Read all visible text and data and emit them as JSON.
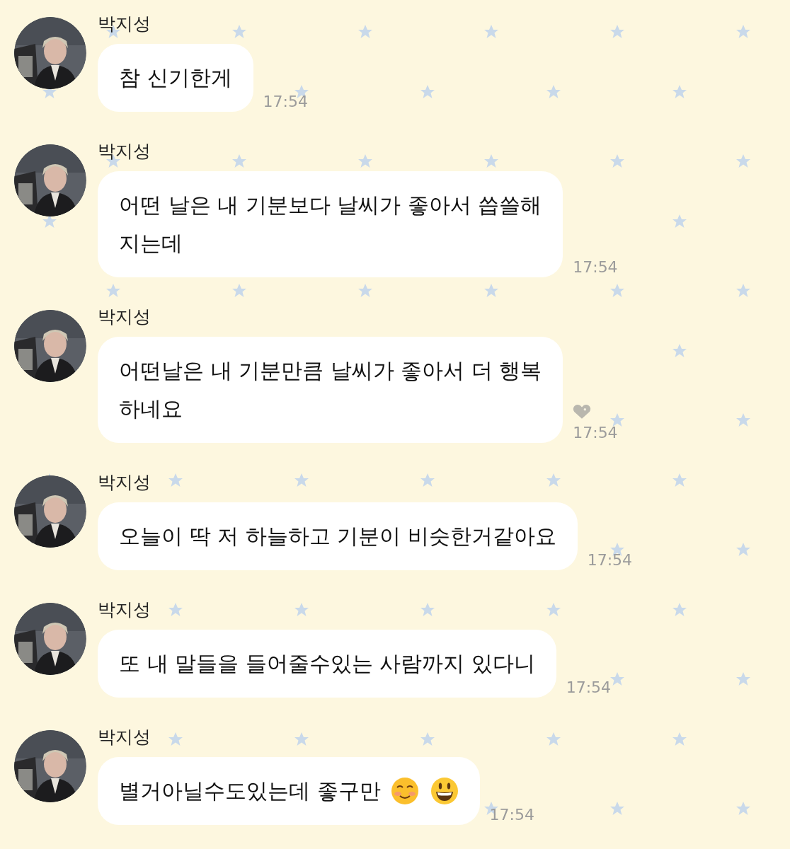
{
  "messages": [
    {
      "sender": "박지성",
      "avatar": {
        "kind": "picture"
      },
      "lines": [
        "참 신기한게"
      ],
      "liked": false,
      "time": "17:54"
    },
    {
      "sender": "박지성",
      "avatar": {
        "kind": "picture"
      },
      "lines": [
        "어떤 날은 내 기분보다 날씨가 좋아서 씁쓸해",
        "지는데"
      ],
      "liked": false,
      "time": "17:54"
    },
    {
      "sender": "박지성",
      "avatar": {
        "kind": "picture"
      },
      "lines": [
        "어떤날은 내 기분만큼 날씨가 좋아서 더 행복",
        "하네요"
      ],
      "liked": true,
      "time": "17:54"
    },
    {
      "sender": "박지성",
      "avatar": {
        "kind": "picture"
      },
      "lines": [
        "오늘이 딱 저 하늘하고 기분이 비슷한거같아요"
      ],
      "liked": false,
      "time": "17:54"
    },
    {
      "sender": "박지성",
      "avatar": {
        "kind": "picture"
      },
      "lines": [
        "또 내 말들을 들어줄수있는 사람까지 있다니"
      ],
      "liked": false,
      "time": "17:54"
    },
    {
      "sender": "박지성",
      "avatar": {
        "kind": "picture"
      },
      "lines": [
        "별거아닐수도있는데 좋구만"
      ],
      "emojis": [
        {
          "kind": "smiling-blush"
        },
        {
          "kind": "grinning"
        }
      ],
      "liked": false,
      "time": "17:54"
    }
  ]
}
